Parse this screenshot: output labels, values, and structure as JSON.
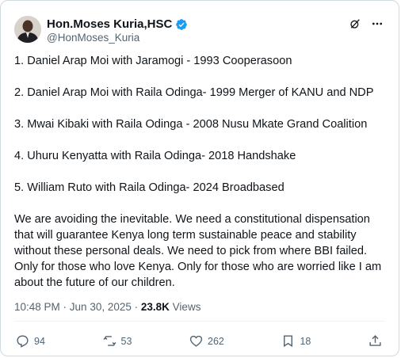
{
  "author": {
    "name": "Hon.Moses Kuria,HSC",
    "handle": "@HonMoses_Kuria"
  },
  "tweet": {
    "lines": [
      "1. Daniel Arap Moi with Jaramogi - 1993 Cooperasoon",
      "2. Daniel Arap Moi with Raila Odinga- 1999 Merger of KANU and NDP",
      "3. Mwai Kibaki with Raila Odinga - 2008 Nusu Mkate Grand Coalition",
      "4. Uhuru Kenyatta with Raila Odinga- 2018 Handshake",
      "5. William Ruto with Raila Odinga- 2024 Broadbased"
    ],
    "paragraph": "We are avoiding the inevitable. We need a constitutional dispensation that will guarantee Kenya long term sustainable  peace and stability without these personal deals. We need to pick from where BBI failed. Only for those who love Kenya. Only for those who are worried like I am about the future of our children."
  },
  "meta": {
    "time": "10:48 PM",
    "separator": " · ",
    "date": "Jun 30, 2025",
    "views_count": "23.8K",
    "views_label": "Views"
  },
  "actions": {
    "replies": "94",
    "reposts": "53",
    "likes": "262",
    "bookmarks": "18"
  },
  "colors": {
    "text": "#0f1419",
    "secondary": "#536471",
    "verified": "#1d9bf0",
    "border": "#cfd9de"
  },
  "icons": [
    "verified-badge-icon",
    "grok-icon",
    "more-icon",
    "reply-icon",
    "repost-icon",
    "like-icon",
    "bookmark-icon",
    "share-icon"
  ]
}
